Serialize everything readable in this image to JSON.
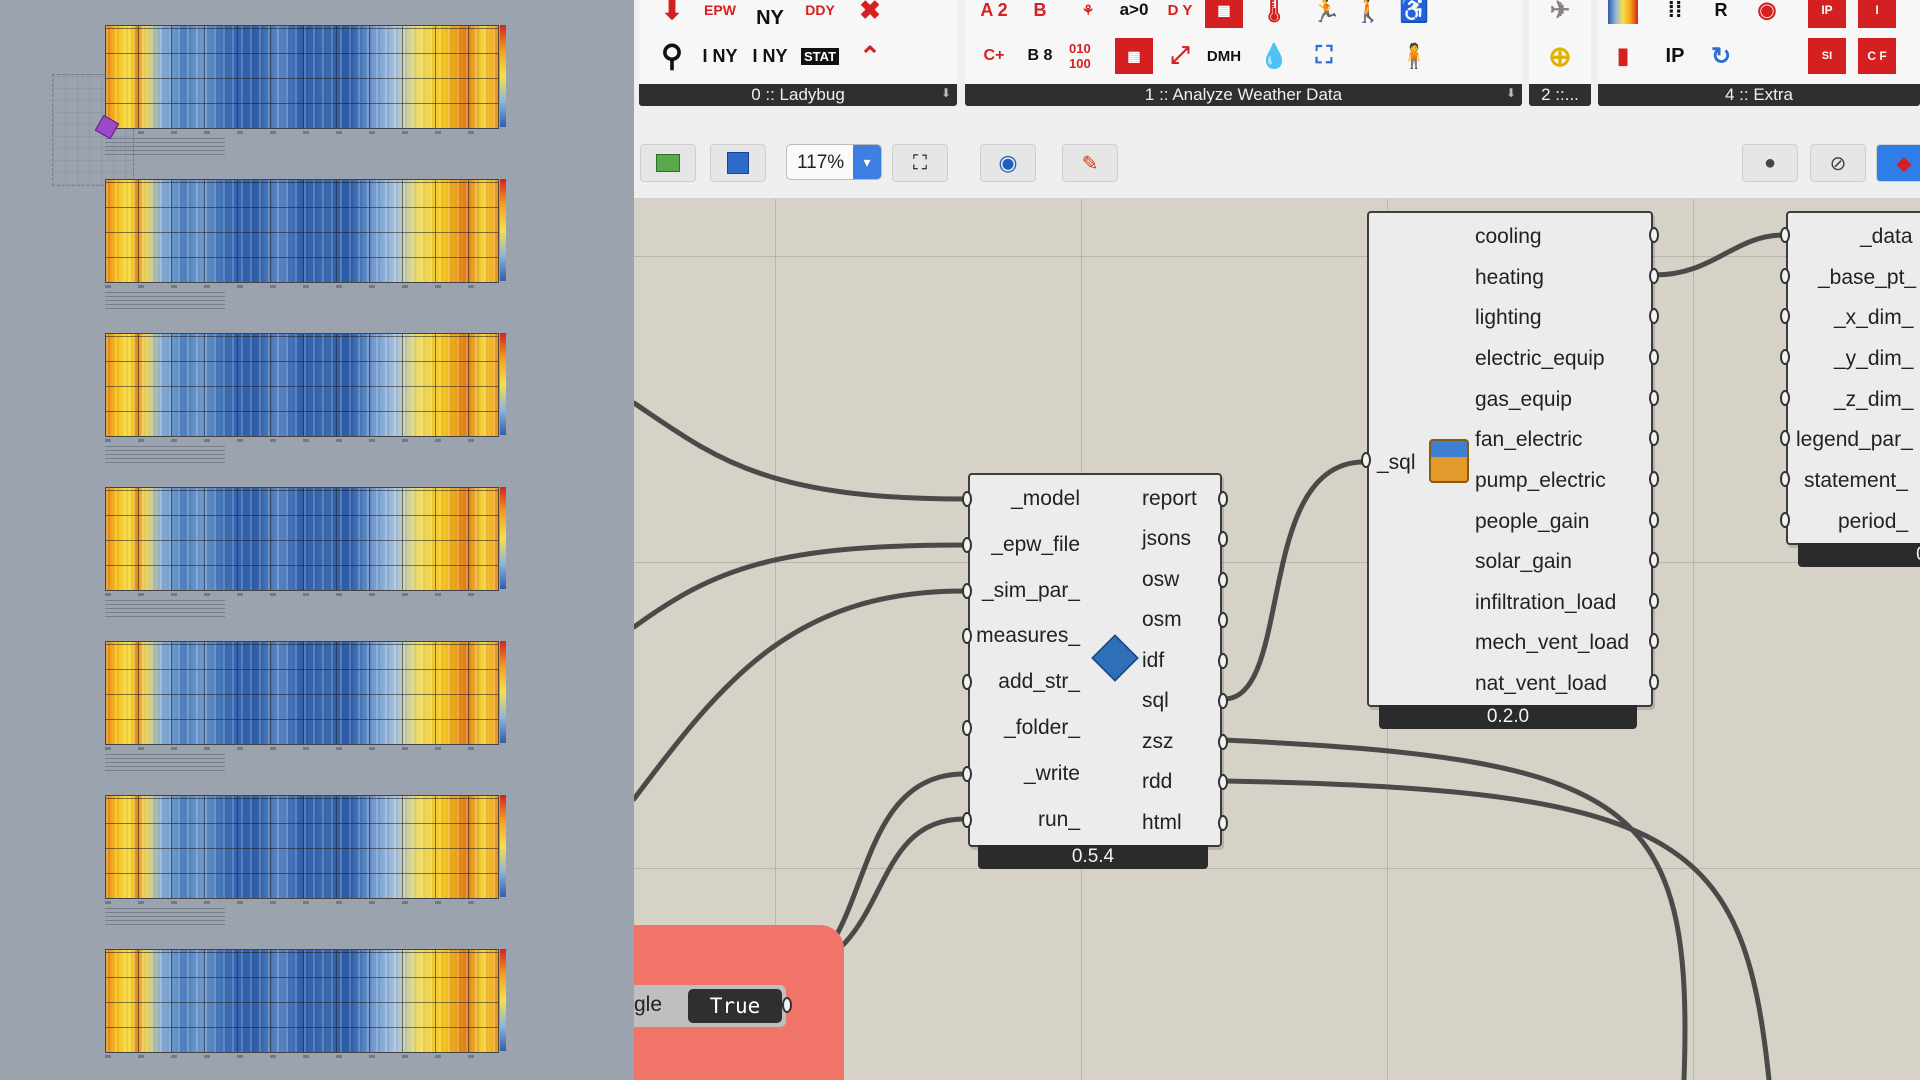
{
  "ribbon": {
    "tabs": [
      {
        "label": "0 :: Ladybug"
      },
      {
        "label": "1 :: Analyze Weather Data"
      },
      {
        "label": "2 ::..."
      },
      {
        "label": "4 :: Extra"
      }
    ],
    "icons": [
      "import-epw-icon",
      "epw-icon",
      "ny-icon",
      "ddy-icon",
      "close-x-icon",
      "search-icon",
      "i-ny-icon",
      "i-x-ny-icon",
      "stat-icon",
      "chart-line-icon"
    ],
    "icon_glyphs": {
      "epw": "EPW",
      "ny": "NY",
      "ddy": "DDY",
      "ny2": "I NY",
      "nyx": "I NY",
      "stat": "STAT",
      "a2": "A 2",
      "b": "B",
      "b8": "B 8",
      "a2b": "A 2",
      "bits": "010 100",
      "agt": "a>0",
      "dy": "D Y",
      "dmh": "DMH",
      "ip": "IP",
      "si": "SI",
      "ip2": "IP",
      "cf": "C F"
    }
  },
  "toolbar": {
    "zoom": "117%",
    "buttons": [
      "open-file-icon",
      "save-icon",
      "zoom-extents-icon",
      "preview-eye-icon",
      "sketch-icon",
      "bake-icon",
      "disable-icon",
      "solid-icon"
    ]
  },
  "run_component": {
    "inputs": [
      "_model",
      "_epw_file",
      "_sim_par_",
      "measures_",
      "add_str_",
      "_folder_",
      "_write",
      "run_"
    ],
    "outputs": [
      "report",
      "jsons",
      "osw",
      "osm",
      "idf",
      "sql",
      "zsz",
      "rdd",
      "html"
    ],
    "version": "0.5.4",
    "icon": "openstudio-icon"
  },
  "read_component": {
    "inputs": [
      "_sql"
    ],
    "outputs": [
      "cooling",
      "heating",
      "lighting",
      "electric_equip",
      "gas_equip",
      "fan_electric",
      "pump_electric",
      "people_gain",
      "solar_gain",
      "infiltration_load",
      "mech_vent_load",
      "nat_vent_load"
    ],
    "version": "0.2.0",
    "icon": "read-results-icon"
  },
  "heatmap_component": {
    "inputs": [
      "_data",
      "_base_pt_",
      "_x_dim_",
      "_y_dim_",
      "_z_dim_",
      "legend_par_",
      "statement_",
      "period_"
    ],
    "version": "0."
  },
  "toggle": {
    "label": "gle",
    "value": "True"
  },
  "colors": {
    "canvas": "#d6d2c7",
    "toggle_group": "#f07468",
    "accent_blue": "#3d7fe0",
    "component_dark": "#2b2b2b"
  }
}
